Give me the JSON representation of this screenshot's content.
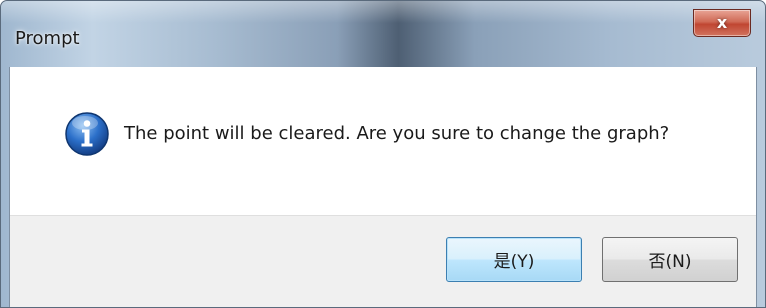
{
  "window": {
    "title": "Prompt",
    "close_icon": "close-icon",
    "close_glyph": "x"
  },
  "dialog": {
    "icon": "info-icon",
    "message": "The point will be cleared. Are you sure to change the graph?"
  },
  "buttons": {
    "yes_label": "是(Y)",
    "no_label": "否(N)"
  },
  "colors": {
    "default_button_border": "#3c7fb1",
    "info_icon_blue": "#1f5fb8"
  }
}
